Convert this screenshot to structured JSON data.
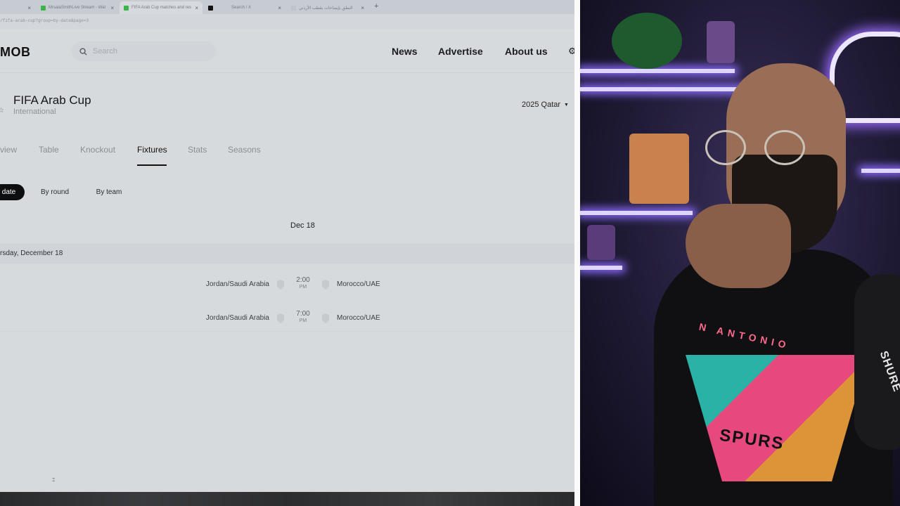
{
  "browser": {
    "tabs": [
      {
        "title": "",
        "favicon_color": "#c7ccd2"
      },
      {
        "title": "MrsalaSmithLive Stream - Wat",
        "favicon_color": "#3bb54a"
      },
      {
        "title": "FIFA Arab Cup matches and res",
        "favicon_color": "#3bb54a",
        "active": true
      },
      {
        "title": "Search / X",
        "favicon_color": "#111111"
      },
      {
        "title": "(1) الأردني / X",
        "favicon_color": "#bfc4ca"
      },
      {
        "title": "النطق بإيضاحات بقطب الأردني",
        "favicon_color": "#bfc4ca"
      }
    ],
    "close_glyph": "×",
    "new_tab_glyph": "+",
    "url": "/fifa-arab-cup?group=by-date&page=3"
  },
  "header": {
    "logo": "MOB",
    "search_placeholder": "Search",
    "nav": [
      "News",
      "Advertise",
      "About us"
    ],
    "settings_glyph": "⚙"
  },
  "competition": {
    "title": "FIFA Arab Cup",
    "subtitle": "International",
    "season": "2025 Qatar",
    "season_caret": "▼",
    "star_glyph": "☆"
  },
  "sections": {
    "tabs": [
      "view",
      "Table",
      "Knockout",
      "Fixtures",
      "Stats",
      "Seasons"
    ],
    "active_tab": "Fixtures"
  },
  "grouping": {
    "options": [
      "date",
      "By round",
      "By team"
    ],
    "active": "date"
  },
  "fixtures": {
    "date_header": "Dec 18",
    "day_label": "rsday, December 18",
    "matches": [
      {
        "home": "Jordan/Saudi Arabia",
        "time": "2:00",
        "ampm": "PM",
        "away": "Morocco/UAE"
      },
      {
        "home": "Jordan/Saudi Arabia",
        "time": "7:00",
        "ampm": "PM",
        "away": "Morocco/UAE"
      }
    ]
  },
  "webcam": {
    "shirt_arc_text": "N ANTONIO",
    "shirt_logo_text": "SPURS",
    "mic_brand": "SHURE"
  },
  "colors": {
    "page_bg": "#d7dadd",
    "active_pill": "#0d0e10",
    "neon": "#9b6bff"
  }
}
